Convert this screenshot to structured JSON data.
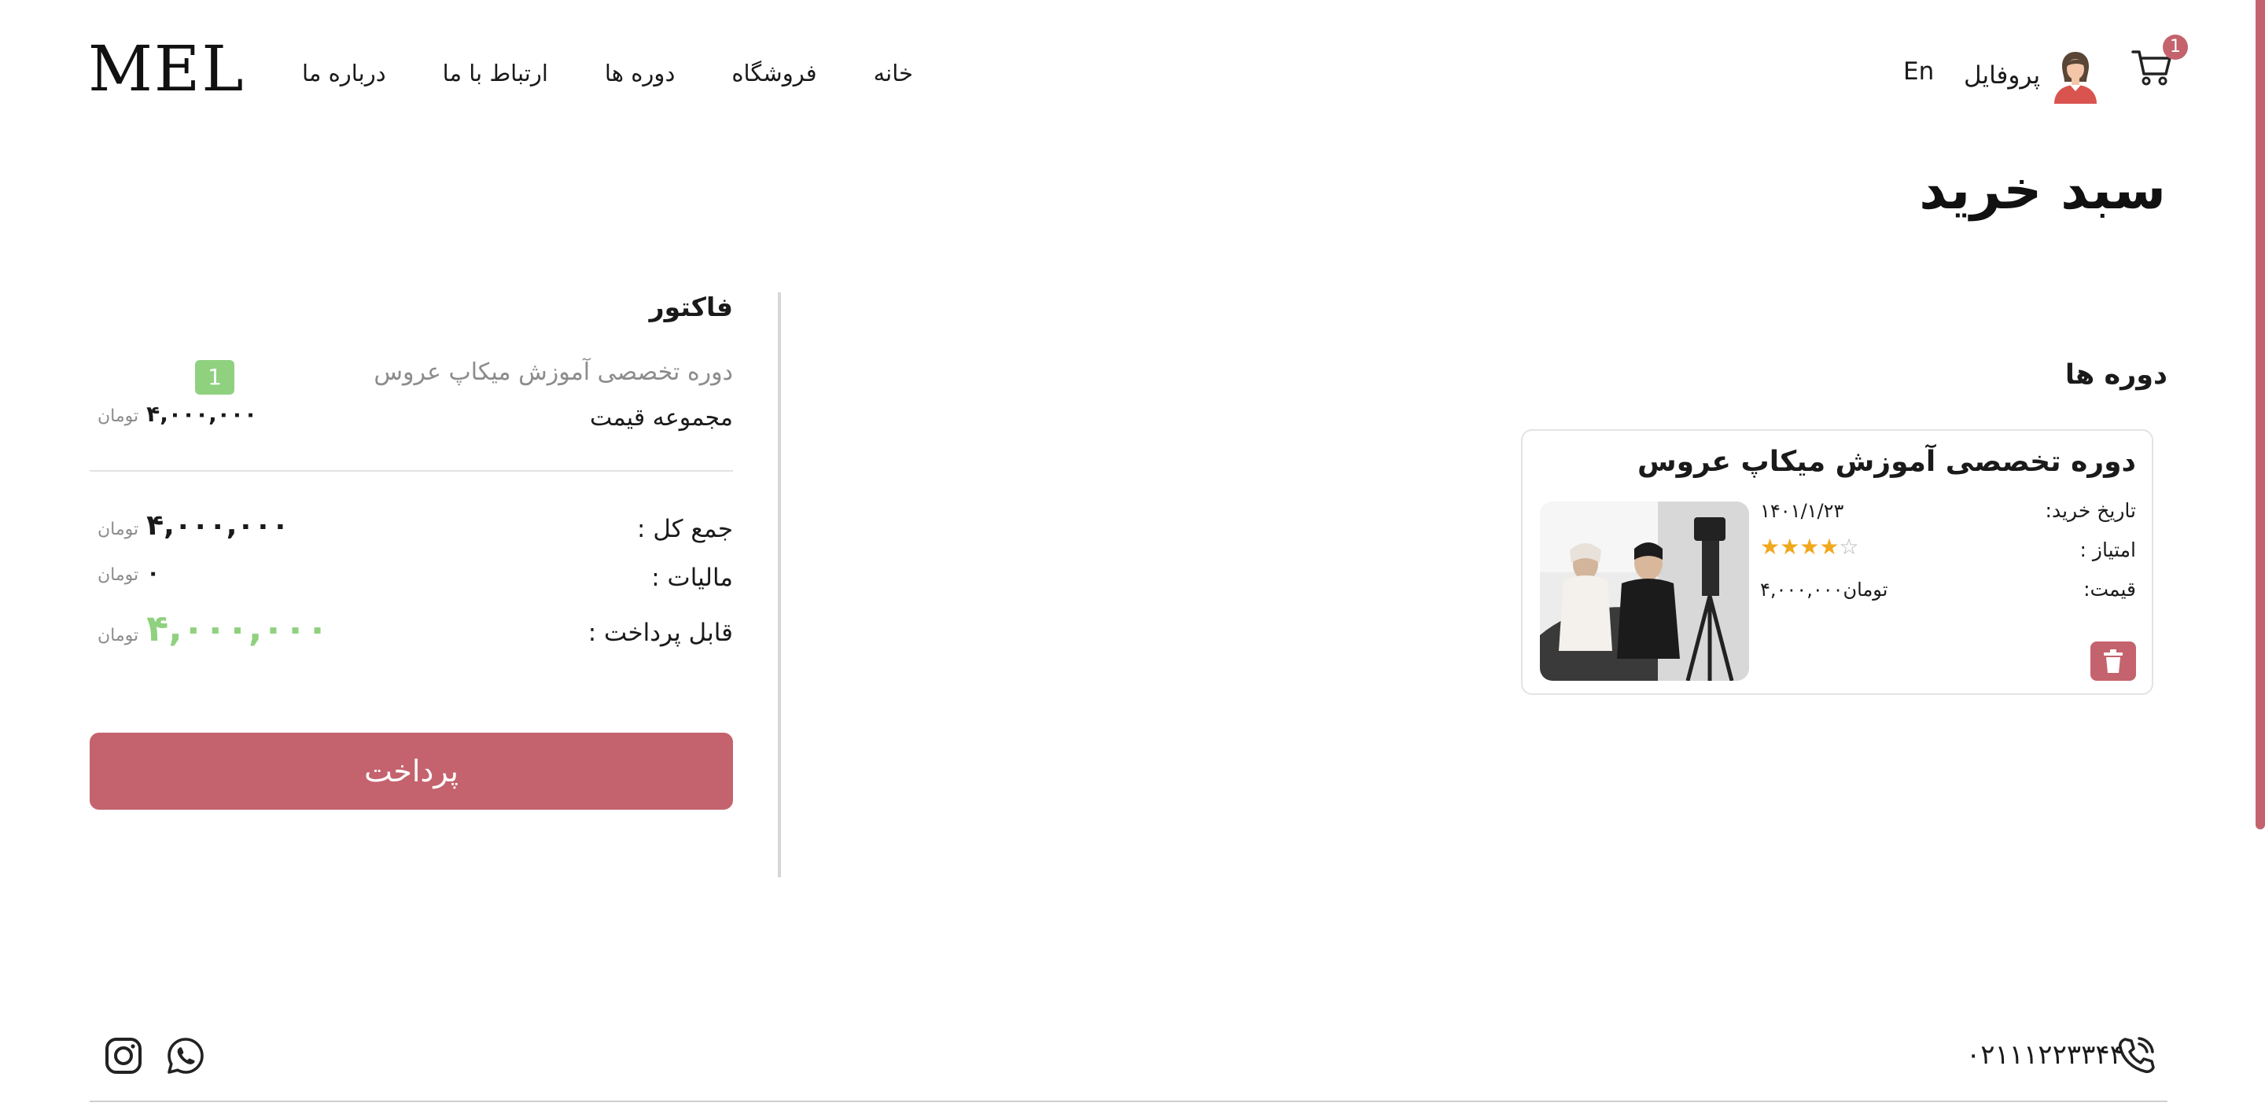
{
  "header": {
    "logo": "MEL",
    "nav": [
      "خانه",
      "فروشگاه",
      "دوره ها",
      "ارتباط با ما",
      "درباره ما"
    ],
    "language": "En",
    "profile_label": "پروفایل",
    "cart_count": "1"
  },
  "page_title": "سبد خرید",
  "invoice": {
    "title": "فاکتور",
    "course_name": "دوره تخصصی آموزش میکاپ عروس",
    "quantity": "1",
    "subtotal_label": "مجموعه قیمت",
    "subtotal_value": "۴,۰۰۰,۰۰۰",
    "currency": "تومان",
    "total_label": "جمع کل :",
    "total_value": "۴,۰۰۰,۰۰۰",
    "tax_label": "مالیات :",
    "tax_value": "۰",
    "payable_label": "قابل پرداخت :",
    "payable_value": "۴,۰۰۰,۰۰۰",
    "pay_button": "پرداخت"
  },
  "courses": {
    "heading": "دوره ها",
    "items": [
      {
        "title": "دوره تخصصی آموزش میکاپ عروس",
        "purchase_date_label": "تاریخ خرید:",
        "purchase_date": "۱۴۰۱/۱/۲۳",
        "rating_label": "امتیاز :",
        "rating": 4,
        "rating_max": 5,
        "price_label": "قیمت:",
        "price": "۴,۰۰۰,۰۰۰تومان"
      }
    ]
  },
  "footer": {
    "phone": "۰۲۱۱۱۲۲۳۳۴۴",
    "social_icons": [
      "instagram-icon",
      "whatsapp-icon"
    ]
  },
  "colors": {
    "accent": "#c4636d",
    "success": "#8fd17f",
    "star": "#f0a81c"
  }
}
